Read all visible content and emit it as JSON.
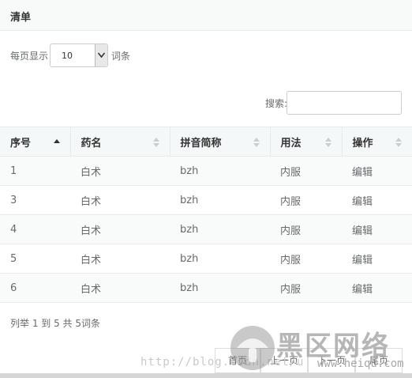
{
  "panel": {
    "title": "清单"
  },
  "length": {
    "prefix": "每页显示",
    "value": "10",
    "suffix": "词条"
  },
  "search": {
    "label": "搜索:",
    "value": ""
  },
  "table": {
    "columns": [
      "序号",
      "药名",
      "拼音简称",
      "用法",
      "操作"
    ],
    "rows": [
      {
        "id": "1",
        "name": "白术",
        "pinyin": "bzh",
        "usage": "内服",
        "action": "编辑"
      },
      {
        "id": "3",
        "name": "白术",
        "pinyin": "bzh",
        "usage": "内服",
        "action": "编辑"
      },
      {
        "id": "4",
        "name": "白术",
        "pinyin": "bzh",
        "usage": "内服",
        "action": "编辑"
      },
      {
        "id": "5",
        "name": "白术",
        "pinyin": "bzh",
        "usage": "内服",
        "action": "编辑"
      },
      {
        "id": "6",
        "name": "白术",
        "pinyin": "bzh",
        "usage": "内服",
        "action": "编辑"
      }
    ]
  },
  "info": "列举 1 到 5 共 5词条",
  "pagination": {
    "first": "首页",
    "prev": "上一页",
    "next": "下一页",
    "last": "尾页"
  },
  "watermark": {
    "url": "http://blog.csdn.net/u",
    "brand": "黑区网络",
    "site": "www.heiqu.com"
  },
  "colors": {
    "header_bg": "#f8fafa",
    "row_alt_bg": "#f9fbfb",
    "border": "#e7eaec",
    "text": "#676a6c"
  }
}
